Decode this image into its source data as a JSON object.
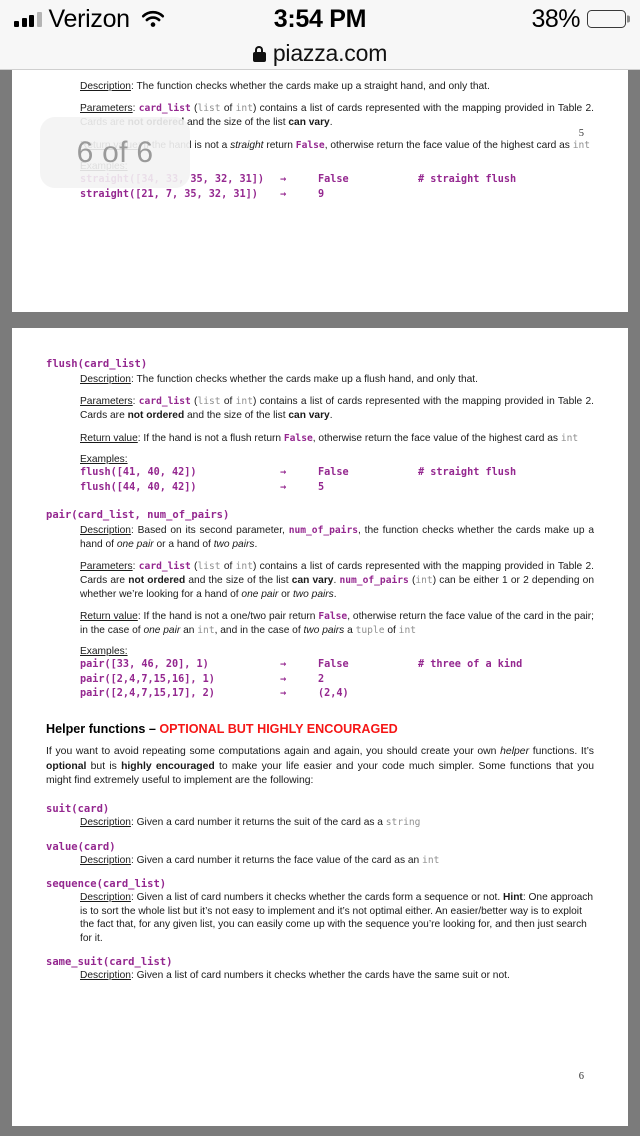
{
  "status_bar": {
    "carrier": "Verizon",
    "time": "3:54 PM",
    "battery_percent": "38%",
    "signal_bars_filled": 3,
    "signal_bars_total": 4,
    "wifi": "wifi-icon",
    "battery_level_fraction": 0.38
  },
  "browser": {
    "url": "piazza.com",
    "lock": "lock-icon"
  },
  "viewer": {
    "page_indicator": "6 of 6"
  },
  "pages": [
    {
      "number": "5",
      "sections": [
        {
          "name": "straight",
          "signature": null,
          "description_label": "Description",
          "description": ": The function checks whether the cards make up a straight hand, and only that.",
          "parameters_label": "Parameters",
          "parameters_html": ": <span class=\"code\">card_list</span> (<span class=\"ty\">list</span> of <span class=\"ty\">int</span>) contains a list of cards represented with the mapping provided in Table 2. Cards are <b>not ordered</b> and the size of the list <b>can vary</b>.",
          "return_label": "Return value",
          "return_html": ": If the hand is not a <i>straight</i> return <span class=\"code\">False</span>, otherwise return the face value of the highest card as <span class=\"ty\">int</span>",
          "examples_label": "Examples:",
          "examples": [
            {
              "call": "straight([34, 33, 35, 32, 31])",
              "arrow": "→",
              "value": "False",
              "note": "# straight flush"
            },
            {
              "call": "straight([21, 7, 35, 32, 31])",
              "arrow": "→",
              "value": "9",
              "note": ""
            }
          ]
        }
      ]
    },
    {
      "number": "6",
      "sections": [
        {
          "name": "flush",
          "signature": "flush(card_list)",
          "description_label": "Description",
          "description": ": The function checks whether the cards make up a flush hand, and only that.",
          "parameters_label": "Parameters",
          "parameters_html": ": <span class=\"code\">card_list</span> (<span class=\"ty\">list</span> of <span class=\"ty\">int</span>) contains a list of cards represented with the mapping provided in Table 2. Cards are <b>not ordered</b> and the size of the list <b>can vary</b>.",
          "return_label": "Return value",
          "return_html": ": If the hand is not a flush return <span class=\"code\">False</span>, otherwise return the face value of the highest card as <span class=\"ty\">int</span>",
          "examples_label": "Examples:",
          "examples": [
            {
              "call": "flush([41, 40, 42])",
              "arrow": "→",
              "value": "False",
              "note": "# straight flush"
            },
            {
              "call": "flush([44, 40, 42])",
              "arrow": "→",
              "value": "5",
              "note": ""
            }
          ]
        },
        {
          "name": "pair",
          "signature": "pair(card_list, num_of_pairs)",
          "description_label": "Description",
          "description_html": ": Based on its second parameter, <span class=\"code\">num_of_pairs</span>, the function checks whether the cards make up a hand of <i>one pair</i> or a hand of <i>two pairs</i>.",
          "parameters_label": "Parameters",
          "parameters_html": ": <span class=\"code\">card_list</span> (<span class=\"ty\">list</span> of <span class=\"ty\">int</span>) contains a list of cards represented with the mapping provided in Table 2. Cards are <b>not ordered</b> and the size of the list <b>can vary</b>. <span class=\"code\">num_of_pairs</span> (<span class=\"ty\">int</span>) can be either 1 or 2 depending on whether we’re looking for a hand of <i>one pair</i> or <i>two pairs</i>.",
          "return_label": "Return value",
          "return_html": ": If the hand is not a one/two pair return <span class=\"code\">False</span>, otherwise return the face value of the card in the pair; in the case of <i>one pair</i> an <span class=\"ty\">int</span>, and in the case of <i>two pairs</i> a <span class=\"ty\">tuple</span> of <span class=\"ty\">int</span>",
          "examples_label": "Examples:",
          "examples": [
            {
              "call": "pair([33, 46, 20], 1)",
              "arrow": "→",
              "value": "False",
              "note": "# three of a kind"
            },
            {
              "call": "pair([2,4,7,15,16], 1)",
              "arrow": "→",
              "value": "2",
              "note": ""
            },
            {
              "call": "pair([2,4,7,15,17], 2)",
              "arrow": "→",
              "value": "(2,4)",
              "note": ""
            }
          ]
        }
      ],
      "helper": {
        "heading_black": "Helper functions – ",
        "heading_red": "OPTIONAL BUT HIGHLY ENCOURAGED",
        "body_html": "If you want to avoid repeating some computations again and again, you should create your own <i>helper</i> functions. It’s <b>optional</b> but is <b>highly encouraged</b> to make your life easier and your code much simpler. Some functions that you might find extremely useful to implement are the following:",
        "functions": [
          {
            "signature": "suit(card)",
            "description_label": "Description",
            "description_html": ": Given a card number it returns the suit of the card as a <span class=\"ty\">string</span>"
          },
          {
            "signature": "value(card)",
            "description_label": "Description",
            "description_html": ": Given a card number it returns the face value of the card as an <span class=\"ty\">int</span>"
          },
          {
            "signature": "sequence(card_list)",
            "description_label": "Description",
            "description_html": ": Given a list of card numbers it checks whether the cards form a sequence or not. <b>Hint</b>: One approach is to sort the whole list but it’s not easy to implement and it’s not optimal either. An easier/better way is to exploit the fact that, for any given list, you can easily come up with the sequence you’re looking for, and then just search for it."
          },
          {
            "signature": "same_suit(card_list)",
            "description_label": "Description",
            "description_html": ": Given a list of card numbers it checks whether the cards have the same suit or not."
          }
        ]
      }
    }
  ],
  "colors": {
    "code_purple": "#94278f",
    "alert_red": "#f51616",
    "viewer_background": "#7b7b7b",
    "chrome_background": "#f7f7f7",
    "type_gray": "#909090"
  }
}
